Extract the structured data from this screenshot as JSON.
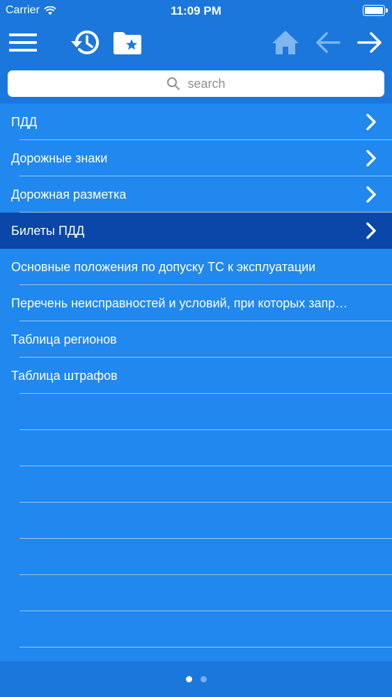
{
  "status_bar": {
    "carrier": "Carrier",
    "time": "11:09 PM"
  },
  "toolbar": {
    "icons": [
      "menu-icon",
      "history-icon",
      "favorites-folder-icon",
      "home-icon",
      "back-arrow-icon",
      "forward-arrow-icon"
    ],
    "back_disabled": true
  },
  "search": {
    "placeholder": "search",
    "value": ""
  },
  "list": {
    "items": [
      {
        "label": "ПДД",
        "has_chevron": true,
        "selected": false
      },
      {
        "label": "Дорожные знаки",
        "has_chevron": true,
        "selected": false
      },
      {
        "label": "Дорожная разметка",
        "has_chevron": true,
        "selected": false
      },
      {
        "label": "Билеты ПДД",
        "has_chevron": true,
        "selected": true
      },
      {
        "label": "Основные положения по допуску ТС к эксплуатации",
        "has_chevron": false,
        "selected": false
      },
      {
        "label": "Перечень неисправностей и условий, при которых запрещается эксплуатация транспортных средств",
        "has_chevron": false,
        "selected": false
      },
      {
        "label": "Таблица регионов",
        "has_chevron": false,
        "selected": false
      },
      {
        "label": "Таблица штрафов",
        "has_chevron": false,
        "selected": false
      }
    ]
  },
  "page_indicator": {
    "pages": 2,
    "current": 1
  },
  "colors": {
    "bar_blue": "#1b77dc",
    "list_blue": "#2088ee",
    "selected_blue": "#0a47a8",
    "disabled_icon": "#7fb6ef"
  }
}
